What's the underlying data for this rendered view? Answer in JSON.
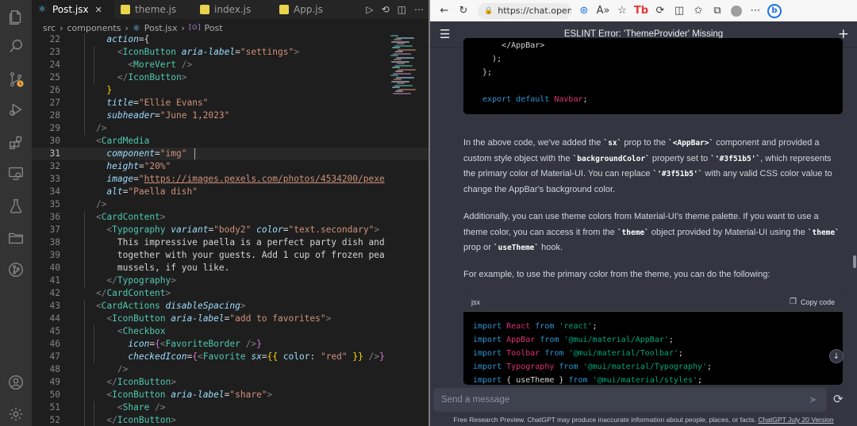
{
  "vscode": {
    "tabs": [
      {
        "name": "Post.jsx",
        "active": true,
        "icon_color": "#61dafb"
      },
      {
        "name": "theme.js",
        "active": false,
        "icon_color": "#e8d44d"
      },
      {
        "name": "index.js",
        "active": false,
        "icon_color": "#e8d44d"
      },
      {
        "name": "App.js",
        "active": false,
        "icon_color": "#e8d44d"
      }
    ],
    "tab_close_glyph": "✕",
    "breadcrumb": [
      "src",
      "components",
      "Post.jsx",
      "Post"
    ],
    "current_line": 31,
    "lines": [
      {
        "n": "22",
        "tokens": [
          [
            "      ",
            "#d4d4d4"
          ],
          [
            "action",
            "#9cdcfe",
            true
          ],
          [
            "={",
            "#d4d4d4"
          ]
        ]
      },
      {
        "n": "23",
        "tokens": [
          [
            "        ",
            "#d4d4d4"
          ],
          [
            "<",
            "#808080"
          ],
          [
            "IconButton",
            "#4ec9b0"
          ],
          [
            " ",
            "#d4d4d4"
          ],
          [
            "aria-label",
            "#9cdcfe",
            true
          ],
          [
            "=",
            "#d4d4d4"
          ],
          [
            "\"settings\"",
            "#ce9178"
          ],
          [
            ">",
            "#808080"
          ]
        ]
      },
      {
        "n": "24",
        "tokens": [
          [
            "          ",
            "#d4d4d4"
          ],
          [
            "<",
            "#808080"
          ],
          [
            "MoreVert",
            "#4ec9b0"
          ],
          [
            " />",
            "#808080"
          ]
        ]
      },
      {
        "n": "25",
        "tokens": [
          [
            "        ",
            "#d4d4d4"
          ],
          [
            "</",
            "#808080"
          ],
          [
            "IconButton",
            "#4ec9b0"
          ],
          [
            ">",
            "#808080"
          ]
        ]
      },
      {
        "n": "26",
        "tokens": [
          [
            "      ",
            "#d4d4d4"
          ],
          [
            "}",
            "#ffd700"
          ]
        ]
      },
      {
        "n": "27",
        "tokens": [
          [
            "      ",
            "#d4d4d4"
          ],
          [
            "title",
            "#9cdcfe",
            true
          ],
          [
            "=",
            "#d4d4d4"
          ],
          [
            "\"Ellie Evans\"",
            "#ce9178"
          ]
        ]
      },
      {
        "n": "28",
        "tokens": [
          [
            "      ",
            "#d4d4d4"
          ],
          [
            "subheader",
            "#9cdcfe",
            true
          ],
          [
            "=",
            "#d4d4d4"
          ],
          [
            "\"June 1,2023\"",
            "#ce9178"
          ]
        ]
      },
      {
        "n": "29",
        "tokens": [
          [
            "    ",
            "#d4d4d4"
          ],
          [
            "/>",
            "#808080"
          ]
        ]
      },
      {
        "n": "30",
        "tokens": [
          [
            "    ",
            "#d4d4d4"
          ],
          [
            "<",
            "#808080"
          ],
          [
            "CardMedia",
            "#4ec9b0"
          ]
        ]
      },
      {
        "n": "31",
        "tokens": [
          [
            "      ",
            "#d4d4d4"
          ],
          [
            "component",
            "#9cdcfe",
            true
          ],
          [
            "=",
            "#d4d4d4"
          ],
          [
            "\"img\"",
            "#ce9178"
          ]
        ]
      },
      {
        "n": "32",
        "tokens": [
          [
            "      ",
            "#d4d4d4"
          ],
          [
            "height",
            "#9cdcfe",
            true
          ],
          [
            "=",
            "#d4d4d4"
          ],
          [
            "\"20%\"",
            "#ce9178"
          ]
        ]
      },
      {
        "n": "33",
        "tokens": [
          [
            "      ",
            "#d4d4d4"
          ],
          [
            "image",
            "#9cdcfe",
            true
          ],
          [
            "=",
            "#d4d4d4"
          ],
          [
            "\"",
            "#ce9178"
          ],
          [
            "https://images.pexels.com/photos/4534200/pexe",
            "#ce9178",
            false,
            true
          ]
        ]
      },
      {
        "n": "34",
        "tokens": [
          [
            "      ",
            "#d4d4d4"
          ],
          [
            "alt",
            "#9cdcfe",
            true
          ],
          [
            "=",
            "#d4d4d4"
          ],
          [
            "\"Paella dish\"",
            "#ce9178"
          ]
        ]
      },
      {
        "n": "35",
        "tokens": [
          [
            "    ",
            "#d4d4d4"
          ],
          [
            "/>",
            "#808080"
          ]
        ]
      },
      {
        "n": "36",
        "tokens": [
          [
            "    ",
            "#d4d4d4"
          ],
          [
            "<",
            "#808080"
          ],
          [
            "CardContent",
            "#4ec9b0"
          ],
          [
            ">",
            "#808080"
          ]
        ]
      },
      {
        "n": "37",
        "tokens": [
          [
            "      ",
            "#d4d4d4"
          ],
          [
            "<",
            "#808080"
          ],
          [
            "Typography",
            "#4ec9b0"
          ],
          [
            " ",
            "#d4d4d4"
          ],
          [
            "variant",
            "#9cdcfe",
            true
          ],
          [
            "=",
            "#d4d4d4"
          ],
          [
            "\"body2\"",
            "#ce9178"
          ],
          [
            " ",
            "#d4d4d4"
          ],
          [
            "color",
            "#9cdcfe",
            true
          ],
          [
            "=",
            "#d4d4d4"
          ],
          [
            "\"text.secondary\"",
            "#ce9178"
          ],
          [
            ">",
            "#808080"
          ]
        ]
      },
      {
        "n": "38",
        "tokens": [
          [
            "        This impressive paella is a perfect party dish and",
            "#d4d4d4"
          ]
        ]
      },
      {
        "n": "39",
        "tokens": [
          [
            "        together with your guests. Add 1 cup of frozen pea",
            "#d4d4d4"
          ]
        ]
      },
      {
        "n": "40",
        "tokens": [
          [
            "        mussels, if you like.",
            "#d4d4d4"
          ]
        ]
      },
      {
        "n": "41",
        "tokens": [
          [
            "      ",
            "#d4d4d4"
          ],
          [
            "</",
            "#808080"
          ],
          [
            "Typography",
            "#4ec9b0"
          ],
          [
            ">",
            "#808080"
          ]
        ]
      },
      {
        "n": "42",
        "tokens": [
          [
            "    ",
            "#d4d4d4"
          ],
          [
            "</",
            "#808080"
          ],
          [
            "CardContent",
            "#4ec9b0"
          ],
          [
            ">",
            "#808080"
          ]
        ]
      },
      {
        "n": "43",
        "tokens": [
          [
            "    ",
            "#d4d4d4"
          ],
          [
            "<",
            "#808080"
          ],
          [
            "CardActions",
            "#4ec9b0"
          ],
          [
            " ",
            "#d4d4d4"
          ],
          [
            "disableSpacing",
            "#9cdcfe",
            true
          ],
          [
            ">",
            "#808080"
          ]
        ]
      },
      {
        "n": "44",
        "tokens": [
          [
            "      ",
            "#d4d4d4"
          ],
          [
            "<",
            "#808080"
          ],
          [
            "IconButton",
            "#4ec9b0"
          ],
          [
            " ",
            "#d4d4d4"
          ],
          [
            "aria-label",
            "#9cdcfe",
            true
          ],
          [
            "=",
            "#d4d4d4"
          ],
          [
            "\"add to favorites\"",
            "#ce9178"
          ],
          [
            ">",
            "#808080"
          ]
        ]
      },
      {
        "n": "45",
        "tokens": [
          [
            "        ",
            "#d4d4d4"
          ],
          [
            "<",
            "#808080"
          ],
          [
            "Checkbox",
            "#4ec9b0"
          ]
        ]
      },
      {
        "n": "46",
        "tokens": [
          [
            "          ",
            "#d4d4d4"
          ],
          [
            "icon",
            "#9cdcfe",
            true
          ],
          [
            "=",
            "#d4d4d4"
          ],
          [
            "{",
            "#da70d6"
          ],
          [
            "<",
            "#808080"
          ],
          [
            "FavoriteBorder",
            "#4ec9b0"
          ],
          [
            " />",
            "#808080"
          ],
          [
            "}",
            "#da70d6"
          ]
        ]
      },
      {
        "n": "47",
        "tokens": [
          [
            "          ",
            "#d4d4d4"
          ],
          [
            "checkedIcon",
            "#9cdcfe",
            true
          ],
          [
            "=",
            "#d4d4d4"
          ],
          [
            "{",
            "#da70d6"
          ],
          [
            "<",
            "#808080"
          ],
          [
            "Favorite",
            "#4ec9b0"
          ],
          [
            " ",
            "#d4d4d4"
          ],
          [
            "sx",
            "#9cdcfe",
            true
          ],
          [
            "=",
            "#d4d4d4"
          ],
          [
            "{{ ",
            "#ffd700"
          ],
          [
            "color",
            "#9cdcfe"
          ],
          [
            ": ",
            "#d4d4d4"
          ],
          [
            "\"red\"",
            "#ce9178"
          ],
          [
            " }}",
            "#ffd700"
          ],
          [
            " />",
            "#808080"
          ],
          [
            "}",
            "#da70d6"
          ]
        ]
      },
      {
        "n": "48",
        "tokens": [
          [
            "        ",
            "#d4d4d4"
          ],
          [
            "/>",
            "#808080"
          ]
        ]
      },
      {
        "n": "49",
        "tokens": [
          [
            "      ",
            "#d4d4d4"
          ],
          [
            "</",
            "#808080"
          ],
          [
            "IconButton",
            "#4ec9b0"
          ],
          [
            ">",
            "#808080"
          ]
        ]
      },
      {
        "n": "50",
        "tokens": [
          [
            "      ",
            "#d4d4d4"
          ],
          [
            "<",
            "#808080"
          ],
          [
            "IconButton",
            "#4ec9b0"
          ],
          [
            " ",
            "#d4d4d4"
          ],
          [
            "aria-label",
            "#9cdcfe",
            true
          ],
          [
            "=",
            "#d4d4d4"
          ],
          [
            "\"share\"",
            "#ce9178"
          ],
          [
            ">",
            "#808080"
          ]
        ]
      },
      {
        "n": "51",
        "tokens": [
          [
            "        ",
            "#d4d4d4"
          ],
          [
            "<",
            "#808080"
          ],
          [
            "Share",
            "#4ec9b0"
          ],
          [
            " />",
            "#808080"
          ]
        ]
      },
      {
        "n": "52",
        "tokens": [
          [
            "      ",
            "#d4d4d4"
          ],
          [
            "</",
            "#808080"
          ],
          [
            "IconButton",
            "#4ec9b0"
          ],
          [
            ">",
            "#808080"
          ]
        ]
      }
    ]
  },
  "browser": {
    "url": "https://chat.open...",
    "chat_title": "ESLINT Error: 'ThemeProvider' Missing",
    "top_code": [
      [
        [
          "      </AppBar>",
          "#d4d4d4"
        ]
      ],
      [
        [
          "    );",
          "#d4d4d4"
        ]
      ],
      [
        [
          "  };",
          "#d4d4d4"
        ]
      ],
      [
        [
          "",
          "#d4d4d4"
        ]
      ],
      [
        [
          "  export default ",
          "#2e95d3"
        ],
        [
          "Navbar",
          "#df3079"
        ],
        [
          ";",
          "#d4d4d4"
        ]
      ]
    ],
    "para1": [
      "In the above code, we've added the ",
      {
        "c": "`sx`"
      },
      " prop to the ",
      {
        "c": "`<AppBar>`"
      },
      " component and provided a custom style object with the ",
      {
        "c": "`backgroundColor`"
      },
      " property set to ",
      {
        "c": "`'#3f51b5'`"
      },
      ", which represents the primary color of Material-UI. You can replace ",
      {
        "c": "`'#3f51b5'`"
      },
      " with any valid CSS color value to change the AppBar's background color."
    ],
    "para2": [
      "Additionally, you can use theme colors from Material-UI's theme palette. If you want to use a theme color, you can access it from the ",
      {
        "c": "`theme`"
      },
      " object provided by Material-UI using the ",
      {
        "c": "`theme`"
      },
      " prop or ",
      {
        "c": "`useTheme`"
      },
      " hook."
    ],
    "para3": [
      "For example, to use the primary color from the theme, you can do the following:"
    ],
    "code_lang": "jsx",
    "copy_label": "Copy code",
    "code2": [
      [
        [
          "import ",
          "#2e95d3"
        ],
        [
          "React ",
          "#df3079"
        ],
        [
          "from ",
          "#2e95d3"
        ],
        [
          "'react'",
          "#00a67d"
        ],
        [
          ";",
          "#d4d4d4"
        ]
      ],
      [
        [
          "import ",
          "#2e95d3"
        ],
        [
          "AppBar ",
          "#df3079"
        ],
        [
          "from ",
          "#2e95d3"
        ],
        [
          "'@mui/material/AppBar'",
          "#00a67d"
        ],
        [
          ";",
          "#d4d4d4"
        ]
      ],
      [
        [
          "import ",
          "#2e95d3"
        ],
        [
          "Toolbar ",
          "#df3079"
        ],
        [
          "from ",
          "#2e95d3"
        ],
        [
          "'@mui/material/Toolbar'",
          "#00a67d"
        ],
        [
          ";",
          "#d4d4d4"
        ]
      ],
      [
        [
          "import ",
          "#2e95d3"
        ],
        [
          "Typography ",
          "#df3079"
        ],
        [
          "from ",
          "#2e95d3"
        ],
        [
          "'@mui/material/Typography'",
          "#00a67d"
        ],
        [
          ";",
          "#d4d4d4"
        ]
      ],
      [
        [
          "import ",
          "#2e95d3"
        ],
        [
          "{ useTheme } ",
          "#d4d4d4"
        ],
        [
          "from ",
          "#2e95d3"
        ],
        [
          "'@mui/material/styles'",
          "#00a67d"
        ],
        [
          ";",
          "#d4d4d4"
        ]
      ]
    ],
    "composer_placeholder": "Send a message",
    "footer_text": "Free Research Preview. ChatGPT may produce inaccurate information about people, places, or facts. ",
    "footer_link": "ChatGPT July 20 Version"
  }
}
